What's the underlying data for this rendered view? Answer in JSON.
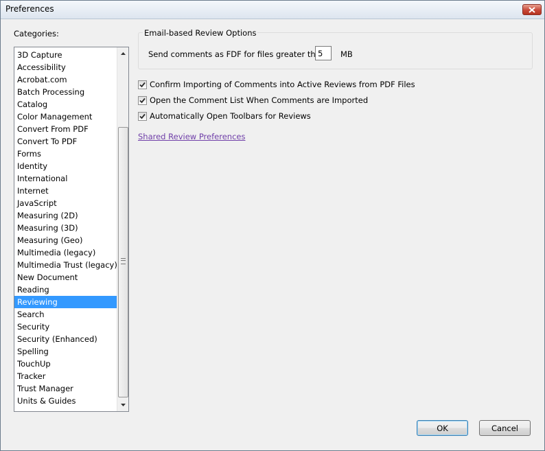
{
  "window": {
    "title": "Preferences"
  },
  "categories": {
    "label": "Categories:",
    "selected": "Reviewing",
    "items": [
      "3D Capture",
      "Accessibility",
      "Acrobat.com",
      "Batch Processing",
      "Catalog",
      "Color Management",
      "Convert From PDF",
      "Convert To PDF",
      "Forms",
      "Identity",
      "International",
      "Internet",
      "JavaScript",
      "Measuring (2D)",
      "Measuring (3D)",
      "Measuring (Geo)",
      "Multimedia (legacy)",
      "Multimedia Trust (legacy)",
      "New Document",
      "Reading",
      "Reviewing",
      "Search",
      "Security",
      "Security (Enhanced)",
      "Spelling",
      "TouchUp",
      "Tracker",
      "Trust Manager",
      "Units & Guides"
    ]
  },
  "email_review": {
    "group_title": "Email-based Review Options",
    "send_label": "Send comments as FDF for files greater than",
    "size_value": "5",
    "unit": "MB"
  },
  "options": [
    {
      "label": "Confirm Importing of Comments into Active Reviews from PDF Files",
      "checked": true
    },
    {
      "label": "Open the Comment List When Comments are Imported",
      "checked": true
    },
    {
      "label": "Automatically Open Toolbars for Reviews",
      "checked": true
    }
  ],
  "shared_review_link": "Shared Review Preferences",
  "buttons": {
    "ok": "OK",
    "cancel": "Cancel"
  }
}
